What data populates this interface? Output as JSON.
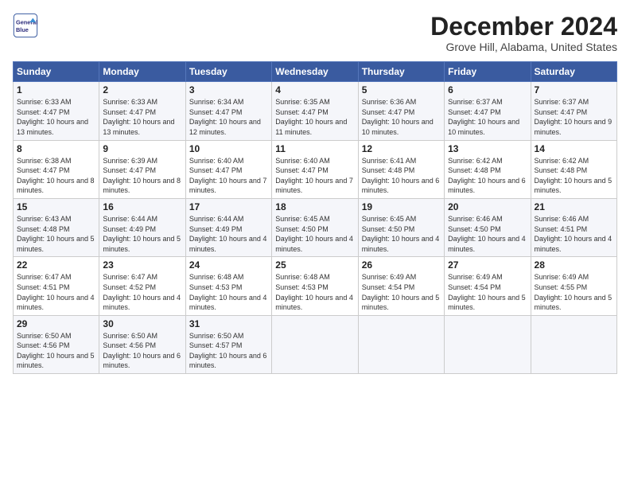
{
  "header": {
    "logo_line1": "General",
    "logo_line2": "Blue",
    "month": "December 2024",
    "location": "Grove Hill, Alabama, United States"
  },
  "weekdays": [
    "Sunday",
    "Monday",
    "Tuesday",
    "Wednesday",
    "Thursday",
    "Friday",
    "Saturday"
  ],
  "weeks": [
    [
      {
        "day": "1",
        "sunrise": "Sunrise: 6:33 AM",
        "sunset": "Sunset: 4:47 PM",
        "daylight": "Daylight: 10 hours and 13 minutes."
      },
      {
        "day": "2",
        "sunrise": "Sunrise: 6:33 AM",
        "sunset": "Sunset: 4:47 PM",
        "daylight": "Daylight: 10 hours and 13 minutes."
      },
      {
        "day": "3",
        "sunrise": "Sunrise: 6:34 AM",
        "sunset": "Sunset: 4:47 PM",
        "daylight": "Daylight: 10 hours and 12 minutes."
      },
      {
        "day": "4",
        "sunrise": "Sunrise: 6:35 AM",
        "sunset": "Sunset: 4:47 PM",
        "daylight": "Daylight: 10 hours and 11 minutes."
      },
      {
        "day": "5",
        "sunrise": "Sunrise: 6:36 AM",
        "sunset": "Sunset: 4:47 PM",
        "daylight": "Daylight: 10 hours and 10 minutes."
      },
      {
        "day": "6",
        "sunrise": "Sunrise: 6:37 AM",
        "sunset": "Sunset: 4:47 PM",
        "daylight": "Daylight: 10 hours and 10 minutes."
      },
      {
        "day": "7",
        "sunrise": "Sunrise: 6:37 AM",
        "sunset": "Sunset: 4:47 PM",
        "daylight": "Daylight: 10 hours and 9 minutes."
      }
    ],
    [
      {
        "day": "8",
        "sunrise": "Sunrise: 6:38 AM",
        "sunset": "Sunset: 4:47 PM",
        "daylight": "Daylight: 10 hours and 8 minutes."
      },
      {
        "day": "9",
        "sunrise": "Sunrise: 6:39 AM",
        "sunset": "Sunset: 4:47 PM",
        "daylight": "Daylight: 10 hours and 8 minutes."
      },
      {
        "day": "10",
        "sunrise": "Sunrise: 6:40 AM",
        "sunset": "Sunset: 4:47 PM",
        "daylight": "Daylight: 10 hours and 7 minutes."
      },
      {
        "day": "11",
        "sunrise": "Sunrise: 6:40 AM",
        "sunset": "Sunset: 4:47 PM",
        "daylight": "Daylight: 10 hours and 7 minutes."
      },
      {
        "day": "12",
        "sunrise": "Sunrise: 6:41 AM",
        "sunset": "Sunset: 4:48 PM",
        "daylight": "Daylight: 10 hours and 6 minutes."
      },
      {
        "day": "13",
        "sunrise": "Sunrise: 6:42 AM",
        "sunset": "Sunset: 4:48 PM",
        "daylight": "Daylight: 10 hours and 6 minutes."
      },
      {
        "day": "14",
        "sunrise": "Sunrise: 6:42 AM",
        "sunset": "Sunset: 4:48 PM",
        "daylight": "Daylight: 10 hours and 5 minutes."
      }
    ],
    [
      {
        "day": "15",
        "sunrise": "Sunrise: 6:43 AM",
        "sunset": "Sunset: 4:48 PM",
        "daylight": "Daylight: 10 hours and 5 minutes."
      },
      {
        "day": "16",
        "sunrise": "Sunrise: 6:44 AM",
        "sunset": "Sunset: 4:49 PM",
        "daylight": "Daylight: 10 hours and 5 minutes."
      },
      {
        "day": "17",
        "sunrise": "Sunrise: 6:44 AM",
        "sunset": "Sunset: 4:49 PM",
        "daylight": "Daylight: 10 hours and 4 minutes."
      },
      {
        "day": "18",
        "sunrise": "Sunrise: 6:45 AM",
        "sunset": "Sunset: 4:50 PM",
        "daylight": "Daylight: 10 hours and 4 minutes."
      },
      {
        "day": "19",
        "sunrise": "Sunrise: 6:45 AM",
        "sunset": "Sunset: 4:50 PM",
        "daylight": "Daylight: 10 hours and 4 minutes."
      },
      {
        "day": "20",
        "sunrise": "Sunrise: 6:46 AM",
        "sunset": "Sunset: 4:50 PM",
        "daylight": "Daylight: 10 hours and 4 minutes."
      },
      {
        "day": "21",
        "sunrise": "Sunrise: 6:46 AM",
        "sunset": "Sunset: 4:51 PM",
        "daylight": "Daylight: 10 hours and 4 minutes."
      }
    ],
    [
      {
        "day": "22",
        "sunrise": "Sunrise: 6:47 AM",
        "sunset": "Sunset: 4:51 PM",
        "daylight": "Daylight: 10 hours and 4 minutes."
      },
      {
        "day": "23",
        "sunrise": "Sunrise: 6:47 AM",
        "sunset": "Sunset: 4:52 PM",
        "daylight": "Daylight: 10 hours and 4 minutes."
      },
      {
        "day": "24",
        "sunrise": "Sunrise: 6:48 AM",
        "sunset": "Sunset: 4:53 PM",
        "daylight": "Daylight: 10 hours and 4 minutes."
      },
      {
        "day": "25",
        "sunrise": "Sunrise: 6:48 AM",
        "sunset": "Sunset: 4:53 PM",
        "daylight": "Daylight: 10 hours and 4 minutes."
      },
      {
        "day": "26",
        "sunrise": "Sunrise: 6:49 AM",
        "sunset": "Sunset: 4:54 PM",
        "daylight": "Daylight: 10 hours and 5 minutes."
      },
      {
        "day": "27",
        "sunrise": "Sunrise: 6:49 AM",
        "sunset": "Sunset: 4:54 PM",
        "daylight": "Daylight: 10 hours and 5 minutes."
      },
      {
        "day": "28",
        "sunrise": "Sunrise: 6:49 AM",
        "sunset": "Sunset: 4:55 PM",
        "daylight": "Daylight: 10 hours and 5 minutes."
      }
    ],
    [
      {
        "day": "29",
        "sunrise": "Sunrise: 6:50 AM",
        "sunset": "Sunset: 4:56 PM",
        "daylight": "Daylight: 10 hours and 5 minutes."
      },
      {
        "day": "30",
        "sunrise": "Sunrise: 6:50 AM",
        "sunset": "Sunset: 4:56 PM",
        "daylight": "Daylight: 10 hours and 6 minutes."
      },
      {
        "day": "31",
        "sunrise": "Sunrise: 6:50 AM",
        "sunset": "Sunset: 4:57 PM",
        "daylight": "Daylight: 10 hours and 6 minutes."
      },
      null,
      null,
      null,
      null
    ]
  ]
}
